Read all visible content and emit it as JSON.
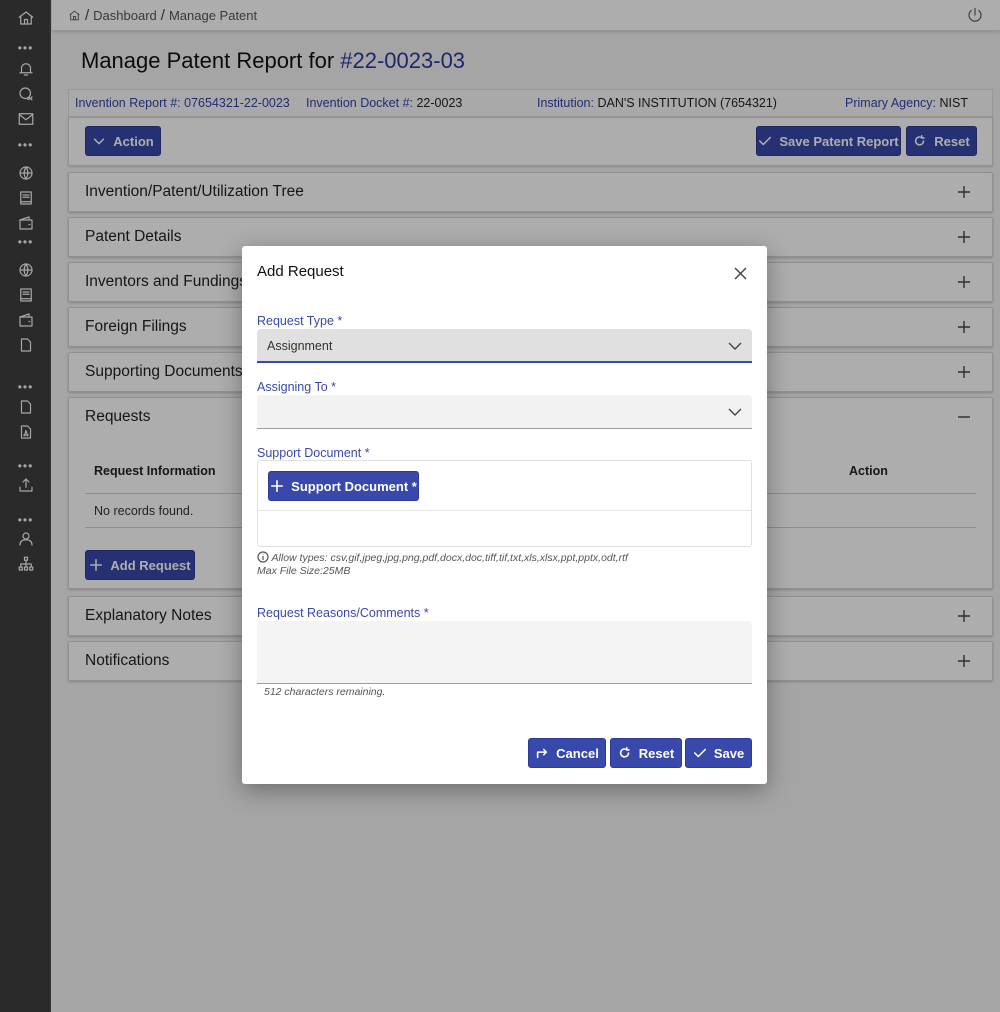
{
  "sidebar": {
    "items": [
      {
        "icon": "home-icon"
      },
      {
        "icon": "bell-icon"
      },
      {
        "icon": "chat-icon"
      },
      {
        "icon": "mail-icon"
      },
      {
        "icon": "globe-icon"
      },
      {
        "icon": "book-icon"
      },
      {
        "icon": "wallet-icon"
      },
      {
        "icon": "globe-icon"
      },
      {
        "icon": "book-icon"
      },
      {
        "icon": "wallet-icon"
      },
      {
        "icon": "file-icon"
      },
      {
        "icon": "file-icon"
      },
      {
        "icon": "pdf-file-icon"
      },
      {
        "icon": "upload-icon"
      },
      {
        "icon": "user-icon"
      },
      {
        "icon": "org-chart-icon"
      }
    ],
    "more_label": "•••"
  },
  "breadcrumb": {
    "items": [
      "Dashboard",
      "Manage Patent"
    ],
    "separator": "/"
  },
  "page": {
    "title_prefix": "Manage Patent Report for ",
    "title_number": "#22-0023-03"
  },
  "info": {
    "invention_report_label": "Invention Report #: ",
    "invention_report_value": "07654321-22-0023",
    "docket_label": "Invention Docket #: ",
    "docket_value": "22-0023",
    "institution_label": "Institution: ",
    "institution_value": "DAN'S INSTITUTION (7654321)",
    "agency_label": "Primary Agency: ",
    "agency_value": "NIST"
  },
  "toolbar": {
    "action_label": "Action",
    "save_label": "Save Patent Report",
    "reset_label": "Reset"
  },
  "panels": [
    {
      "title": "Invention/Patent/Utilization Tree",
      "expanded": false
    },
    {
      "title": "Patent Details",
      "expanded": false
    },
    {
      "title": "Inventors and Fundings",
      "expanded": false
    },
    {
      "title": "Foreign Filings",
      "expanded": false
    },
    {
      "title": "Supporting Documents",
      "expanded": false
    },
    {
      "title": "Requests",
      "expanded": true
    },
    {
      "title": "Explanatory Notes",
      "expanded": false
    },
    {
      "title": "Notifications",
      "expanded": false
    }
  ],
  "requests": {
    "columns": [
      "Request Information",
      "Action"
    ],
    "empty_message": "No records found.",
    "add_label": "Add Request"
  },
  "modal": {
    "title": "Add Request",
    "request_type_label": "Request Type *",
    "request_type_value": "Assignment",
    "assigning_to_label": "Assigning To *",
    "assigning_to_value": "",
    "support_doc_label": "Support Document *",
    "support_doc_button": "Support Document *",
    "allow_types": "Allow types: csv,gif,jpeg,jpg,png,pdf,docx,doc,tiff,tif,txt,xls,xlsx,ppt,pptx,odt,rtf",
    "max_size": "Max File Size:25MB",
    "comments_label": "Request Reasons/Comments *",
    "comments_value": "",
    "chars_remaining": "512 characters remaining.",
    "cancel_label": "Cancel",
    "reset_label": "Reset",
    "save_label": "Save"
  },
  "colors": {
    "primary": "#3949ab",
    "sidebar_bg": "#3f3f3f",
    "label_blue": "#3949ab"
  }
}
